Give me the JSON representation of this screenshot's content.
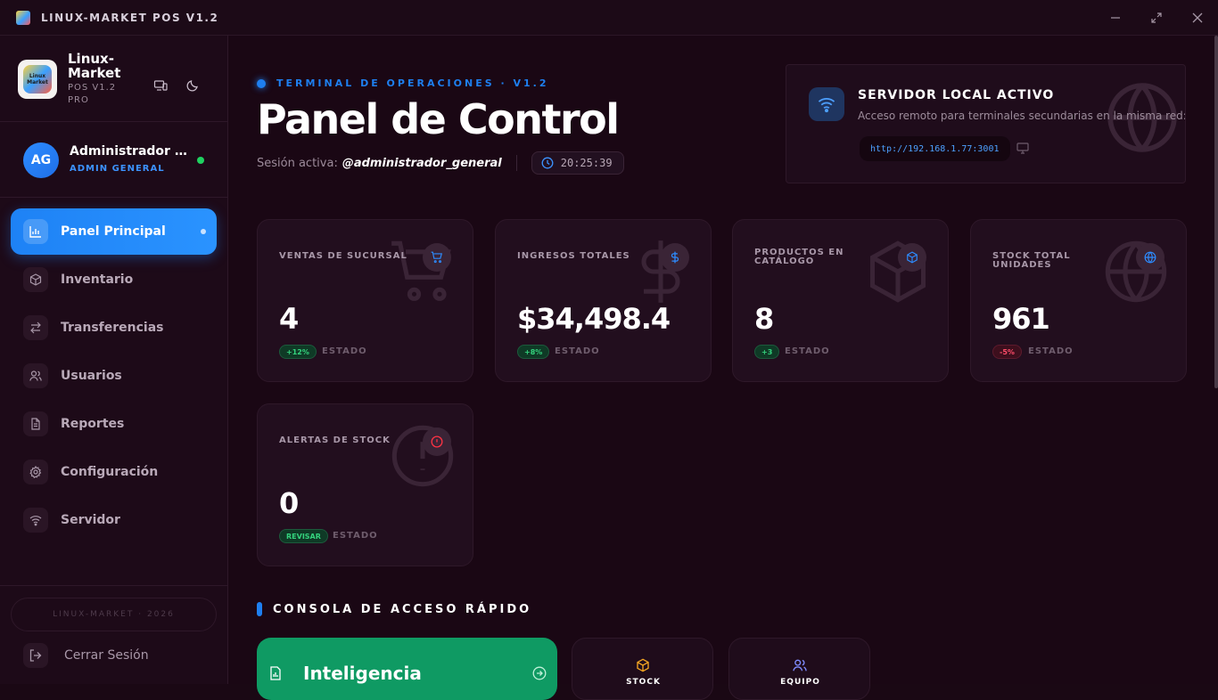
{
  "window": {
    "title": "LINUX-MARKET POS V1.2"
  },
  "sidebar": {
    "brand": {
      "name": "Linux-Market",
      "sub": "POS V1.2 PRO",
      "logo_text": "Linux Market"
    },
    "user": {
      "initials": "AG",
      "name": "Administrador General",
      "role": "ADMIN GENERAL"
    },
    "items": [
      {
        "label": "Panel Principal",
        "icon": "chart-icon",
        "active": true
      },
      {
        "label": "Inventario",
        "icon": "box-icon"
      },
      {
        "label": "Transferencias",
        "icon": "arrows-icon"
      },
      {
        "label": "Usuarios",
        "icon": "users-icon"
      },
      {
        "label": "Reportes",
        "icon": "document-icon"
      },
      {
        "label": "Configuración",
        "icon": "gear-icon"
      },
      {
        "label": "Servidor",
        "icon": "wifi-icon"
      }
    ],
    "footer": "LINUX-MARKET · 2026",
    "logout": "Cerrar Sesión"
  },
  "header": {
    "kicker": "TERMINAL DE OPERACIONES · V1.2",
    "title": "Panel de Control",
    "session_label": "Sesión activa:",
    "session_user": "@administrador_general",
    "clock": "20:25:39"
  },
  "server": {
    "title": "SERVIDOR LOCAL ACTIVO",
    "desc": "Acceso remoto para terminales secundarias en la misma red:",
    "url": "http://192.168.1.77:3001"
  },
  "stats": [
    {
      "label": "VENTAS DE SUCURSAL",
      "value": "4",
      "badge": "+12%",
      "status": "ESTADO",
      "color": "#2d8cff"
    },
    {
      "label": "INGRESOS TOTALES",
      "value": "$34,498.4",
      "badge": "+8%",
      "status": "ESTADO",
      "color": "#2d8cff"
    },
    {
      "label": "PRODUCTOS EN CATÁLOGO",
      "value": "8",
      "badge": "+3",
      "status": "ESTADO",
      "color": "#2d8cff"
    },
    {
      "label": "STOCK TOTAL UNIDADES",
      "value": "961",
      "badge": "-5%",
      "status": "ESTADO",
      "color": "#2d8cff"
    },
    {
      "label": "ALERTAS DE STOCK",
      "value": "0",
      "badge": "REVISAR",
      "status": "ESTADO",
      "color": "#ff3344"
    }
  ],
  "quick": {
    "title": "CONSOLA DE ACCESO RÁPIDO",
    "primary": "Inteligencia",
    "tiles": [
      {
        "label": "STOCK",
        "color": "#f5a623"
      },
      {
        "label": "EQUIPO",
        "color": "#7f8cff"
      }
    ]
  }
}
